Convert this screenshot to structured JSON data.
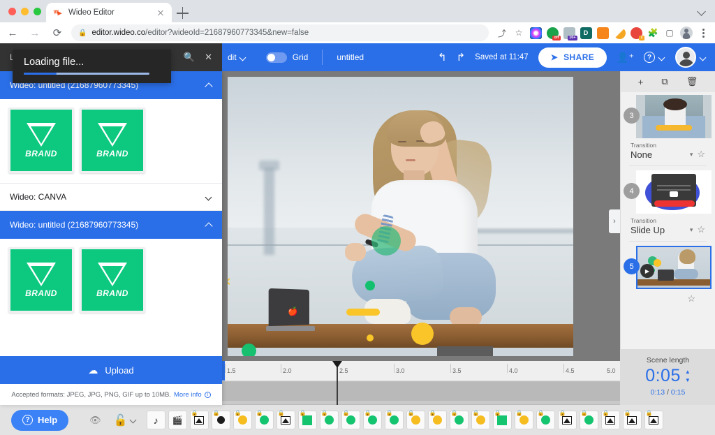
{
  "browser": {
    "tab": {
      "title": "Wideo Editor",
      "favicon": "wideo-logo-icon",
      "close_icon": "close-icon"
    },
    "new_tab_icon": "plus-icon",
    "tab_list_icon": "chevron-down-icon",
    "nav": {
      "back": "◀",
      "forward": "▶",
      "reload": "⟳"
    },
    "omnibox": {
      "lock_icon": "lock-icon",
      "url_domain": "editor.wideo.co",
      "url_path": "/editor?wideoId=21687960773345&new=false"
    },
    "toolbar_icons": [
      "share-icon",
      "bookmark-star-icon"
    ],
    "extensions": [
      {
        "name": "color-wheel-extension",
        "color": "#1a1a2e",
        "badge": "",
        "badge_color": ""
      },
      {
        "name": "adblock-extension",
        "color": "#1aa34a",
        "badge": "off",
        "badge_color": "#e53935"
      },
      {
        "name": "notes-extension",
        "color": "#cfd8dc",
        "badge": "10+",
        "badge_color": "#5e35b1"
      },
      {
        "name": "dashlane-extension",
        "color": "#0f6b63",
        "badge": "",
        "badge_color": ""
      },
      {
        "name": "metamask-extension",
        "color": "#f6851b",
        "badge": "",
        "badge_color": ""
      },
      {
        "name": "honey-extension",
        "color": "#f5a623",
        "badge": "",
        "badge_color": ""
      },
      {
        "name": "loom-extension",
        "color": "#e8453c",
        "badge": "1",
        "badge_color": "#f5a623"
      },
      {
        "name": "puzzle-extensions-icon",
        "color": "#5f6368",
        "badge": "",
        "badge_color": ""
      },
      {
        "name": "sidebar-toggle-icon",
        "color": "#5f6368",
        "badge": "",
        "badge_color": ""
      }
    ],
    "profile_icon": "profile-avatar",
    "menu_icon": "kebab-menu-icon"
  },
  "appbar": {
    "edit_menu_label": "dit",
    "edit_menu_caret": "chevron-down-icon",
    "grid_label": "Grid",
    "grid_toggle_state": "on",
    "document_title": "untitled",
    "undo_icon": "undo-icon",
    "redo_icon": "redo-icon",
    "saved_text": "Saved at 11:47",
    "share_label": "SHARE",
    "share_icon": "send-icon",
    "add_user_icon": "add-user-icon",
    "help_icon": "help-circle-icon",
    "help_caret": "chevron-down-icon",
    "avatar": "user-avatar",
    "avatar_caret": "chevron-down-icon"
  },
  "left_panel": {
    "header_title": "LI",
    "search_icon": "search-icon",
    "close_icon": "close-icon",
    "loading": {
      "text": "Loading file...",
      "progress_percent": 26
    },
    "sections": [
      {
        "label": "Wideo: untitled (21687960773345)",
        "state": "expanded",
        "caret": "chevron-up-icon",
        "items": [
          {
            "label": "BRAND",
            "color": "#0cc97f"
          },
          {
            "label": "BRAND",
            "color": "#0cc97f"
          }
        ]
      },
      {
        "label": "Wideo: CANVA",
        "state": "collapsed",
        "caret": "chevron-down-icon",
        "items": []
      },
      {
        "label": "Wideo: untitled (21687960773345)",
        "state": "expanded",
        "caret": "chevron-up-icon",
        "items": [
          {
            "label": "BRAND",
            "color": "#0cc97f"
          },
          {
            "label": "BRAND",
            "color": "#0cc97f"
          }
        ]
      }
    ],
    "upload_button": {
      "label": "Upload",
      "icon": "cloud-upload-icon"
    },
    "formats_note": "Accepted formats: JPEG, JPG, PNG, GIF up to 10MB.",
    "more_info_link": "More info",
    "more_info_icon": "info-icon"
  },
  "canvas": {
    "next_scene_icon": "chevron-right-icon",
    "scene_description": "Woman sitting cross-legged on a wooden bench with a laptop by the sea"
  },
  "timeline": {
    "ticks": [
      "1.5",
      "2.0",
      "2.5",
      "3.0",
      "3.5",
      "4.0",
      "4.5",
      "5.0"
    ],
    "playhead_position": "2.5"
  },
  "right_panel": {
    "actions": [
      {
        "name": "add-scene-icon",
        "glyph": "+"
      },
      {
        "name": "duplicate-scene-icon",
        "glyph": "⧉"
      },
      {
        "name": "delete-scene-icon",
        "glyph": "🗑"
      }
    ],
    "scenes": [
      {
        "number": "3",
        "selected": false,
        "transition_label": "Transition",
        "transition_value": "None",
        "favorite_icon": "star-outline-icon"
      },
      {
        "number": "4",
        "selected": false,
        "transition_label": "Transition",
        "transition_value": "Slide Up",
        "favorite_icon": "star-outline-icon"
      },
      {
        "number": "5",
        "selected": true,
        "transition_label": "",
        "transition_value": "",
        "favorite_icon": "star-outline-icon"
      }
    ],
    "scene_length": {
      "label": "Scene length",
      "value": "0:05",
      "elapsed": "0:13",
      "separator": "/",
      "total": "0:15",
      "stepper_up": "chevron-up-icon",
      "stepper_down": "chevron-down-icon"
    }
  },
  "bottom_bar": {
    "help_label": "Help",
    "help_icon": "help-circle-icon",
    "visibility_icon": "eye-icon",
    "lock_icon": "unlock-icon",
    "lock_caret": "chevron-down-icon",
    "layers": [
      {
        "name": "layer-audio",
        "shape": "note",
        "locked": false
      },
      {
        "name": "layer-video",
        "shape": "film",
        "locked": false
      },
      {
        "name": "layer-image",
        "shape": "image",
        "locked": true
      },
      {
        "name": "layer-circle-black",
        "shape": "circle-black",
        "locked": true
      },
      {
        "name": "layer-circle-yellow",
        "shape": "circle-yellow",
        "locked": true
      },
      {
        "name": "layer-circle-green",
        "shape": "circle-green",
        "locked": true
      },
      {
        "name": "layer-image",
        "shape": "image",
        "locked": true
      },
      {
        "name": "layer-square-green",
        "shape": "square-green",
        "locked": true
      },
      {
        "name": "layer-circle-green",
        "shape": "circle-green",
        "locked": true
      },
      {
        "name": "layer-circle-green",
        "shape": "circle-green",
        "locked": true
      },
      {
        "name": "layer-circle-green",
        "shape": "circle-green",
        "locked": true
      },
      {
        "name": "layer-circle-green",
        "shape": "circle-green",
        "locked": true
      },
      {
        "name": "layer-circle-yellow",
        "shape": "circle-yellow",
        "locked": true
      },
      {
        "name": "layer-circle-yellow",
        "shape": "circle-yellow",
        "locked": true
      },
      {
        "name": "layer-circle-green",
        "shape": "circle-green",
        "locked": true
      },
      {
        "name": "layer-circle-yellow",
        "shape": "circle-yellow",
        "locked": true
      },
      {
        "name": "layer-square-green",
        "shape": "square-green",
        "locked": true
      },
      {
        "name": "layer-circle-yellow",
        "shape": "circle-yellow",
        "locked": true
      },
      {
        "name": "layer-circle-green",
        "shape": "circle-green",
        "locked": true
      },
      {
        "name": "layer-image",
        "shape": "image",
        "locked": true
      },
      {
        "name": "layer-circle-green",
        "shape": "circle-green",
        "locked": true
      },
      {
        "name": "layer-image",
        "shape": "image",
        "locked": true
      },
      {
        "name": "layer-image",
        "shape": "image",
        "locked": true
      },
      {
        "name": "layer-image",
        "shape": "image",
        "locked": true
      }
    ]
  }
}
